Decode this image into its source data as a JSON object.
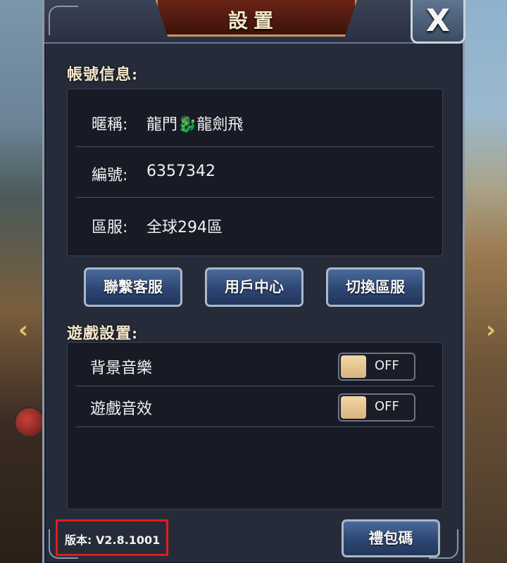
{
  "title": "設置",
  "close_label": "X",
  "account": {
    "section_title": "帳號信息:",
    "rows": [
      {
        "label": "暱稱:",
        "value": "龍門🐉龍劍飛"
      },
      {
        "label": "編號:",
        "value": "6357342"
      },
      {
        "label": "區服:",
        "value": "全球294區"
      }
    ]
  },
  "buttons": {
    "contact": "聯繫客服",
    "user_center": "用戶中心",
    "switch_server": "切換區服",
    "gift_code": "禮包碼"
  },
  "game_settings": {
    "section_title": "遊戲設置:",
    "items": [
      {
        "label": "背景音樂",
        "state": "OFF"
      },
      {
        "label": "遊戲音效",
        "state": "OFF"
      }
    ]
  },
  "version": "版本: V2.8.1001",
  "colors": {
    "panel_bg": "#262b3a",
    "title_plate": "#6a2416",
    "button_blue": "#2e4673",
    "toggle_knob": "#f3d8a8",
    "version_highlight": "#e31b1b"
  }
}
